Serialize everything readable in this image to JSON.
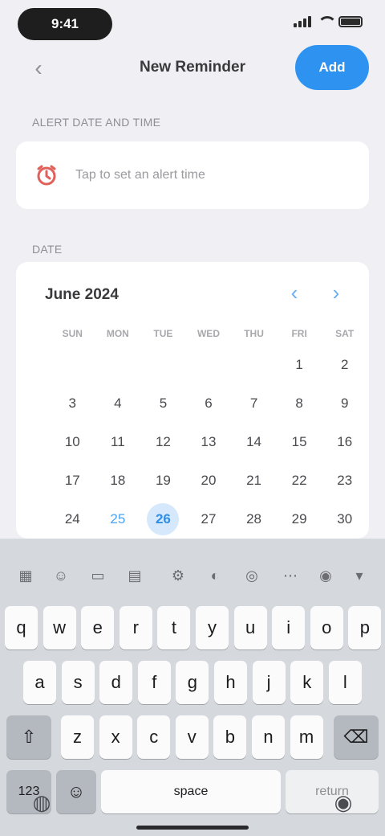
{
  "status_bar": {
    "time": "9:41"
  },
  "nav": {
    "back_icon": "chevron-left-icon",
    "title": "New Reminder",
    "action_label": "Add"
  },
  "sections": {
    "alert_header": "ALERT DATE AND TIME",
    "date_header": "DATE"
  },
  "alert": {
    "icon": "alarm-icon",
    "placeholder": "Tap to set an alert time"
  },
  "calendar": {
    "month_label": "June 2024",
    "prev_icon": "chevron-left-icon",
    "next_icon": "chevron-right-icon",
    "weekdays": [
      "SUN",
      "MON",
      "TUE",
      "WED",
      "THU",
      "FRI",
      "SAT"
    ],
    "days": [
      "",
      "",
      "",
      "",
      "",
      "1",
      "2",
      "3",
      "4",
      "5",
      "6",
      "7",
      "8",
      "9",
      "10",
      "11",
      "12",
      "13",
      "14",
      "15",
      "16",
      "17",
      "18",
      "19",
      "20",
      "21",
      "22",
      "23",
      "24",
      "25",
      "26",
      "27",
      "28",
      "29",
      "30"
    ],
    "today": "25",
    "selected": "26"
  },
  "keyboard": {
    "row1": [
      "q",
      "w",
      "e",
      "r",
      "t",
      "y",
      "u",
      "i",
      "o",
      "p"
    ],
    "row2": [
      "a",
      "s",
      "d",
      "f",
      "g",
      "h",
      "j",
      "k",
      "l"
    ],
    "row3": [
      "z",
      "x",
      "c",
      "v",
      "b",
      "n",
      "m"
    ],
    "shift_icon": "shift-icon",
    "delete_icon": "delete-icon",
    "numbers_label": "123",
    "emoji_icon": "emoji-icon",
    "space_label": "space",
    "return_label": "return",
    "globe_icon": "globe-icon",
    "mic_icon": "mic-icon"
  },
  "colors": {
    "accent": "#2e93f0",
    "selected_bg": "#d6e8fb",
    "alert_icon": "#e0605a"
  }
}
